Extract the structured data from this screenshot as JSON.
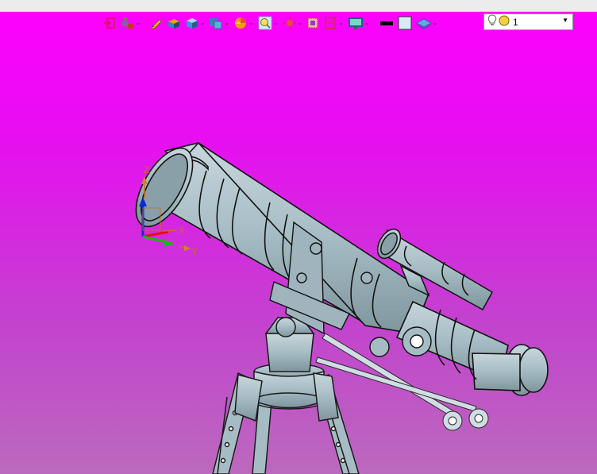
{
  "toolbar": {
    "items": [
      {
        "icon": "exit-sketch-icon",
        "dropdown": false
      },
      {
        "icon": "person-view-icon",
        "dropdown": true
      },
      {
        "icon": "pencil-icon",
        "dropdown": false
      },
      {
        "icon": "box-icon",
        "dropdown": false
      },
      {
        "icon": "cube-icon",
        "dropdown": true
      },
      {
        "icon": "layers-icon",
        "dropdown": true
      },
      {
        "icon": "pie-icon",
        "dropdown": true
      },
      {
        "icon": "zoom-icon",
        "dropdown": true
      },
      {
        "icon": "crosshair-icon",
        "dropdown": true
      },
      {
        "icon": "section-box-icon",
        "dropdown": false
      },
      {
        "icon": "bracket-icon",
        "dropdown": true
      },
      {
        "icon": "monitor-icon",
        "dropdown": true
      },
      {
        "icon": "line-color-icon",
        "dropdown": false
      },
      {
        "icon": "fill-color-icon",
        "dropdown": false
      },
      {
        "icon": "plane-icon",
        "dropdown": true
      }
    ]
  },
  "lighting": {
    "value": "1",
    "icons": [
      "bulb-icon",
      "sun-icon"
    ]
  },
  "viewport": {
    "background_top": "#ff00ff",
    "background_bottom": "#bb69bd",
    "model_color": "#a6bcc4",
    "axes": {
      "x_label": "X",
      "y_label": "Y",
      "z_label": "Z"
    }
  }
}
